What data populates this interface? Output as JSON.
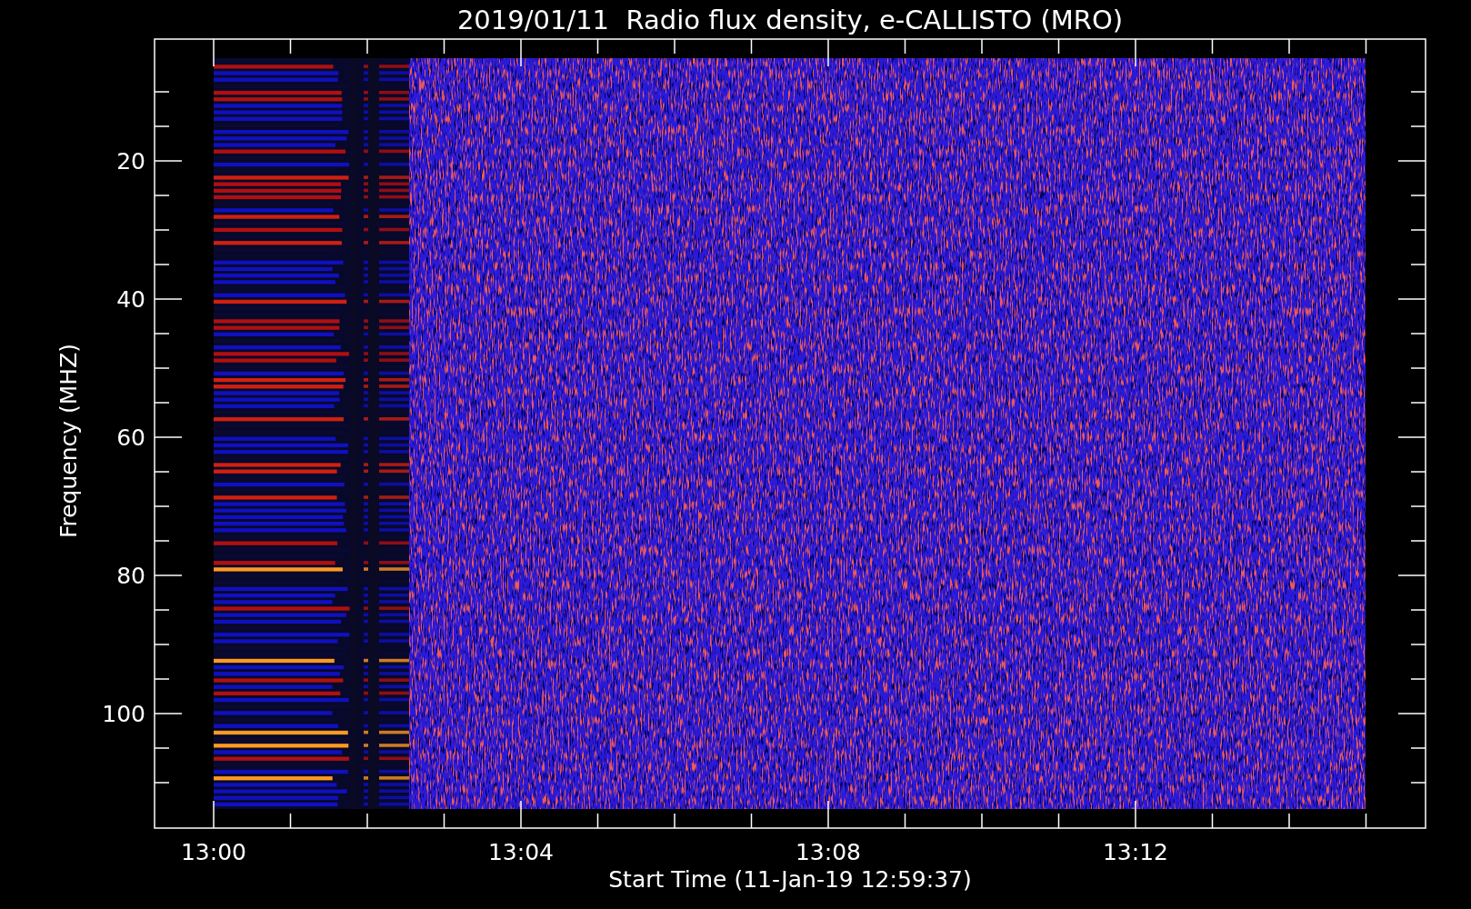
{
  "title": "2019/01/11  Radio flux density, e-CALLISTO (MRO)",
  "y_axis": {
    "label": "Frequency (MHZ)",
    "ticks": [
      "20",
      "40",
      "60",
      "80",
      "100"
    ]
  },
  "x_axis": {
    "label": "Start Time (11-Jan-19 12:59:37)",
    "ticks": [
      "13:00",
      "13:04",
      "13:08",
      "13:12"
    ]
  }
}
